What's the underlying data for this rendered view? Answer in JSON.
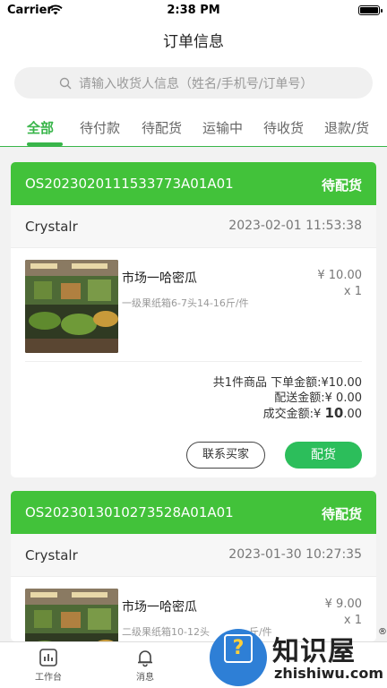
{
  "status_bar": {
    "carrier": "Carrier",
    "time": "2:38 PM"
  },
  "nav": {
    "title": "订单信息"
  },
  "search": {
    "placeholder": "请输入收货人信息（姓名/手机号/订单号）",
    "icon": "search-icon"
  },
  "tabs": [
    {
      "label": "全部",
      "active": true
    },
    {
      "label": "待付款",
      "active": false
    },
    {
      "label": "待配货",
      "active": false
    },
    {
      "label": "运输中",
      "active": false
    },
    {
      "label": "待收货",
      "active": false
    },
    {
      "label": "退款/货",
      "active": false
    }
  ],
  "orders": [
    {
      "order_no": "OS2023020111533773A01A01",
      "status": "待配货",
      "buyer": "Crystalr",
      "datetime": "2023-02-01 11:53:38",
      "product": {
        "name": "市场一哈密瓜",
        "spec": "一级果纸箱6-7头14-16斤/件",
        "price": "¥ 10.00",
        "qty": "x 1"
      },
      "summary": {
        "count_label": "共1件商品",
        "order_amount_label": "下单金额:",
        "order_amount": "¥10.00",
        "shipping_label": "配送金额:",
        "shipping": "¥ 0.00",
        "deal_label": "成交金额:",
        "deal_currency": "¥",
        "deal_amount": "10",
        "deal_decimals": ".00"
      },
      "buttons": {
        "contact": "联系买家",
        "pick": "配货"
      }
    },
    {
      "order_no": "OS2023013010273528A01A01",
      "status": "待配货",
      "buyer": "Crystalr",
      "datetime": "2023-01-30 10:27:35",
      "product": {
        "name": "市场一哈密瓜",
        "spec": "二级果纸箱10-12头",
        "spec_tail": "斤/件",
        "price": "¥ 9.00",
        "qty": "x 1"
      }
    }
  ],
  "tabbar": [
    {
      "label": "工作台",
      "icon": "chart-icon"
    },
    {
      "label": "消息",
      "icon": "bell-icon"
    }
  ],
  "watermark": {
    "cn": "知识屋",
    "en": "zhishiwu.com",
    "reg": "®"
  },
  "colors": {
    "accent": "#39b54a",
    "header_green": "#42c23a",
    "button_green": "#2cbe5b"
  }
}
